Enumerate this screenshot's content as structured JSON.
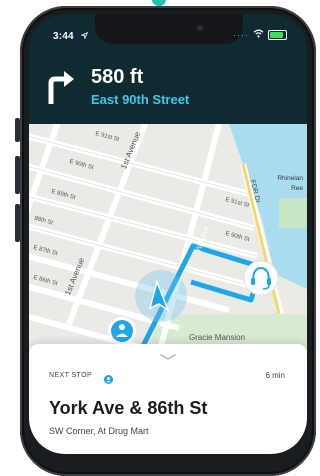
{
  "status_bar": {
    "time": "3:44"
  },
  "navigation": {
    "distance": "580 ft",
    "street": "East 90th Street",
    "maneuver_icon": "turn-right-arrow-icon"
  },
  "map": {
    "street_labels": [
      "E 91st St",
      "E 90th St",
      "E 89th St",
      "88th St",
      "E 87th St",
      "E 86th St",
      "E 91st St",
      "E 90th St"
    ],
    "avenue_labels": [
      "1st Avenue",
      "1st Avenue",
      "York Ave",
      "FDR Dr"
    ],
    "rhinelander": [
      "Rhinelan",
      "Ree"
    ],
    "gracie": "Gracie Mansion",
    "route_color": "#1ea7e8"
  },
  "next_stop": {
    "label": "NEXT STOP",
    "eta": "6 min",
    "name": "York Ave & 86th St",
    "detail": "SW Corner, At Drug Mart"
  }
}
